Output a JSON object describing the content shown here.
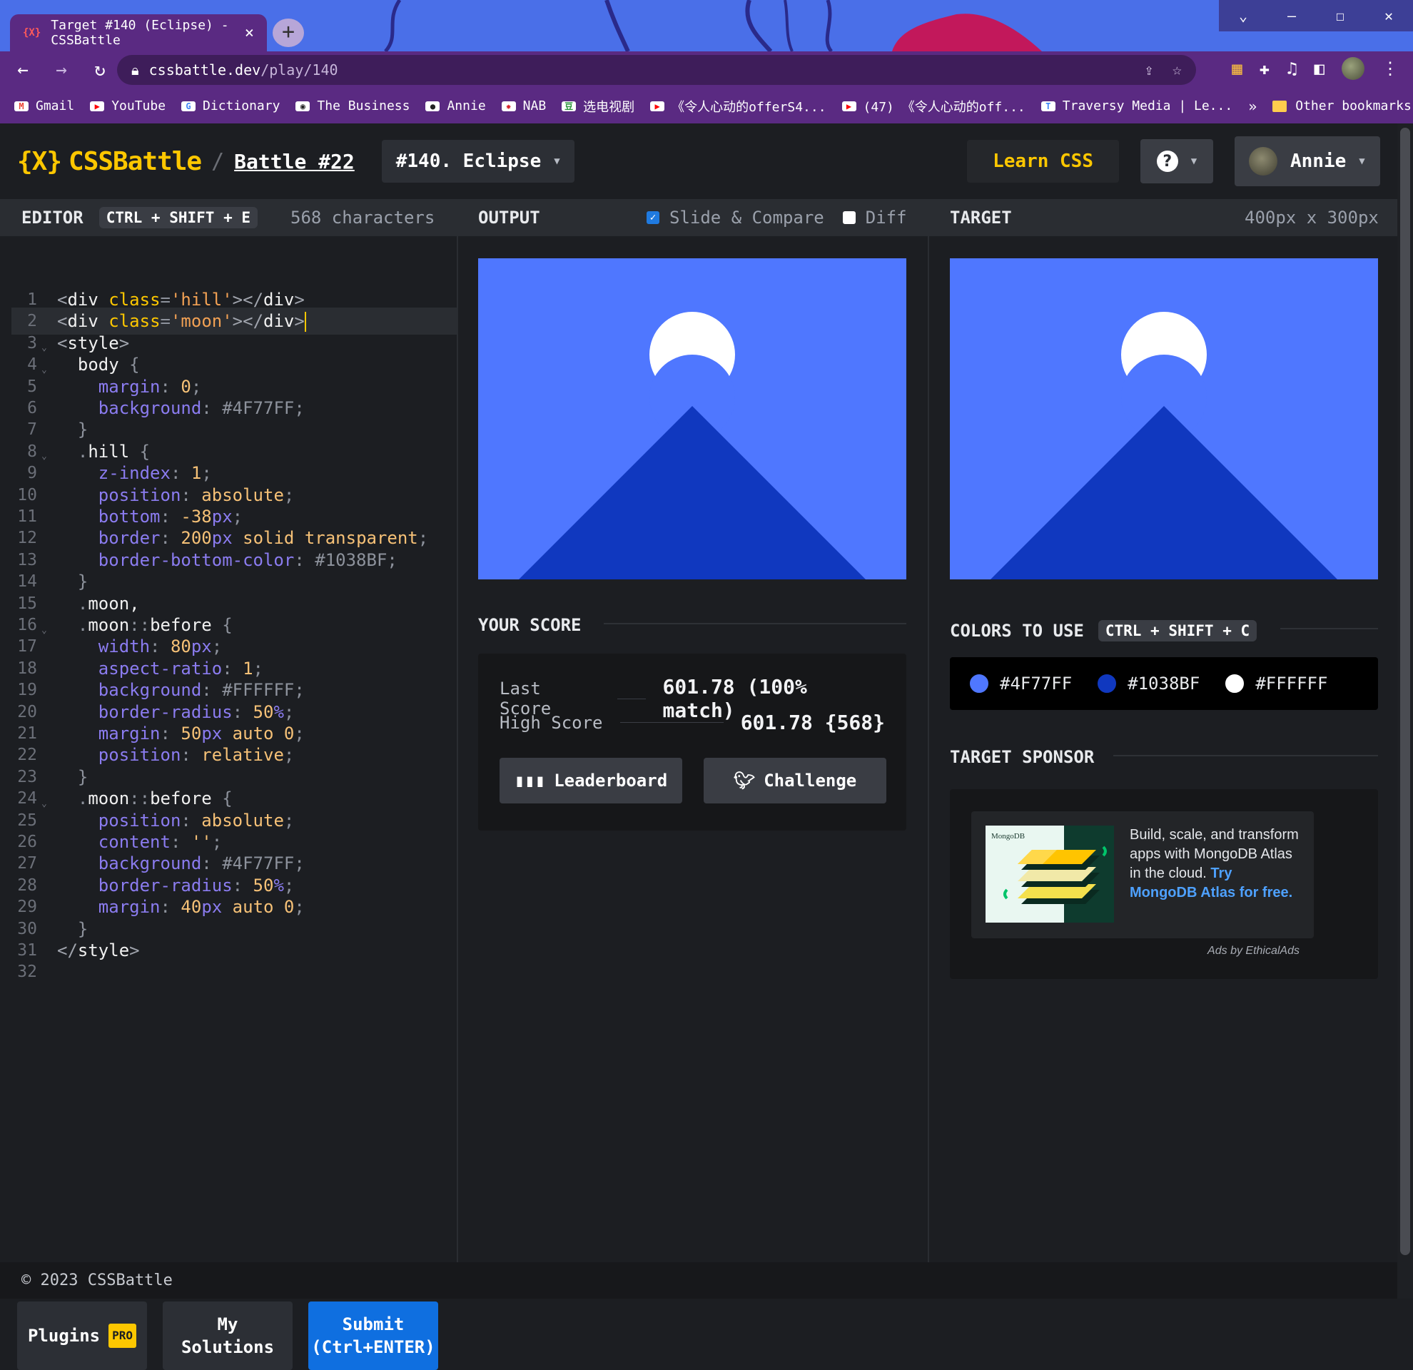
{
  "browser": {
    "tab_title": "Target #140 (Eclipse) - CSSBattle",
    "tab_favicon": "{X}",
    "url_host": "cssbattle.dev",
    "url_path": "/play/140",
    "bookmarks": [
      {
        "label": "Gmail",
        "icon": "gmail-icon",
        "color": "#ea4335",
        "glyph": "M"
      },
      {
        "label": "YouTube",
        "icon": "youtube-icon",
        "color": "#ff0000",
        "glyph": "▶"
      },
      {
        "label": "Dictionary",
        "icon": "google-icon",
        "color": "#4285f4",
        "glyph": "G"
      },
      {
        "label": "The Business",
        "icon": "abc-icon",
        "color": "#222222",
        "glyph": "◉"
      },
      {
        "label": "Annie",
        "icon": "github-icon",
        "color": "#222222",
        "glyph": "●"
      },
      {
        "label": "NAB",
        "icon": "nab-star-icon",
        "color": "#d8232a",
        "glyph": "✸"
      },
      {
        "label": "选电视剧",
        "icon": "douban-icon",
        "color": "#2e963d",
        "glyph": "豆"
      },
      {
        "label": "《令人心动的offerS4...",
        "icon": "youtube-icon",
        "color": "#ff0000",
        "glyph": "▶"
      },
      {
        "label": "(47) 《令人心动的off...",
        "icon": "youtube-icon",
        "color": "#ff0000",
        "glyph": "▶"
      },
      {
        "label": "Traversy Media | Le...",
        "icon": "traversy-icon",
        "color": "#3b82f6",
        "glyph": "T"
      }
    ],
    "bookmarks_more": "»",
    "other_bookmarks": "Other bookmarks"
  },
  "header": {
    "logo": "{X} CSSBattle",
    "logo_mark": "{X}",
    "logo_text": "CSSBattle",
    "slash": "/",
    "battle": "Battle #22",
    "target_select": "#140. Eclipse",
    "learn_css": "Learn CSS",
    "user_name": "Annie"
  },
  "columns": {
    "editor": "EDITOR",
    "editor_shortcut": "CTRL + SHIFT + E",
    "characters": "568 characters",
    "output": "OUTPUT",
    "slide_compare": "Slide & Compare",
    "slide_compare_checked": true,
    "diff": "Diff",
    "diff_checked": false,
    "target": "TARGET",
    "target_size": "400px x 300px"
  },
  "editor": {
    "line_numbers": [
      "1",
      "2",
      "3",
      "4",
      "5",
      "6",
      "7",
      "8",
      "9",
      "10",
      "11",
      "12",
      "13",
      "14",
      "15",
      "16",
      "17",
      "18",
      "19",
      "20",
      "21",
      "22",
      "23",
      "24",
      "25",
      "26",
      "27",
      "28",
      "29",
      "30",
      "31",
      "32"
    ],
    "code": [
      "<div class='hill'></div>",
      "<div class='moon'></div>",
      "<style>",
      "  body {",
      "    margin: 0;",
      "    background: #4F77FF;",
      "  }",
      "  .hill {",
      "    z-index: 1;",
      "    position: absolute;",
      "    bottom: -38px;",
      "    border: 200px solid transparent;",
      "    border-bottom-color: #1038BF;",
      "  }",
      "  .moon,",
      "  .moon::before {",
      "    width: 80px;",
      "    aspect-ratio: 1;",
      "    background: #FFFFFF;",
      "    border-radius: 50%;",
      "    margin: 50px auto 0;",
      "    position: relative;",
      "  }",
      "  .moon::before {",
      "    position: absolute;",
      "    content: '';",
      "    background: #4F77FF;",
      "    border-radius: 50%;",
      "    margin: 40px auto 0;",
      "  }",
      "</style>",
      ""
    ],
    "fold_lines": [
      3,
      4,
      8,
      16,
      24
    ],
    "active_line": 2
  },
  "editor_buttons": {
    "plugins": "Plugins",
    "pro": "PRO",
    "my_solutions_1": "My",
    "my_solutions_2": "Solutions",
    "submit_1": "Submit",
    "submit_2": "(Ctrl+ENTER)"
  },
  "score": {
    "title": "YOUR SCORE",
    "last_label": "Last Score",
    "last_value": "601.78 (100% match)",
    "high_label": "High Score",
    "high_value": "601.78 {568}",
    "leaderboard": "Leaderboard",
    "challenge": "Challenge"
  },
  "colors": {
    "title": "COLORS TO USE",
    "shortcut": "CTRL + SHIFT + C",
    "list": [
      "#4F77FF",
      "#1038BF",
      "#FFFFFF"
    ]
  },
  "sponsor": {
    "title": "TARGET SPONSOR",
    "brand": "MongoDB",
    "text": "Build, scale, and transform apps with MongoDB Atlas in the cloud. ",
    "link": "Try MongoDB Atlas for free.",
    "ads_by": "Ads by EthicalAds"
  },
  "footer": {
    "copyright": "© 2023 CSSBattle"
  },
  "theme": {
    "bg": "#1c1e22",
    "accent_yellow": "#fdc700",
    "submit_blue": "#0f6fe0",
    "chrome_purple": "#5a2a82",
    "target_bg": "#4F77FF",
    "hill": "#1038BF",
    "moon": "#FFFFFF"
  }
}
